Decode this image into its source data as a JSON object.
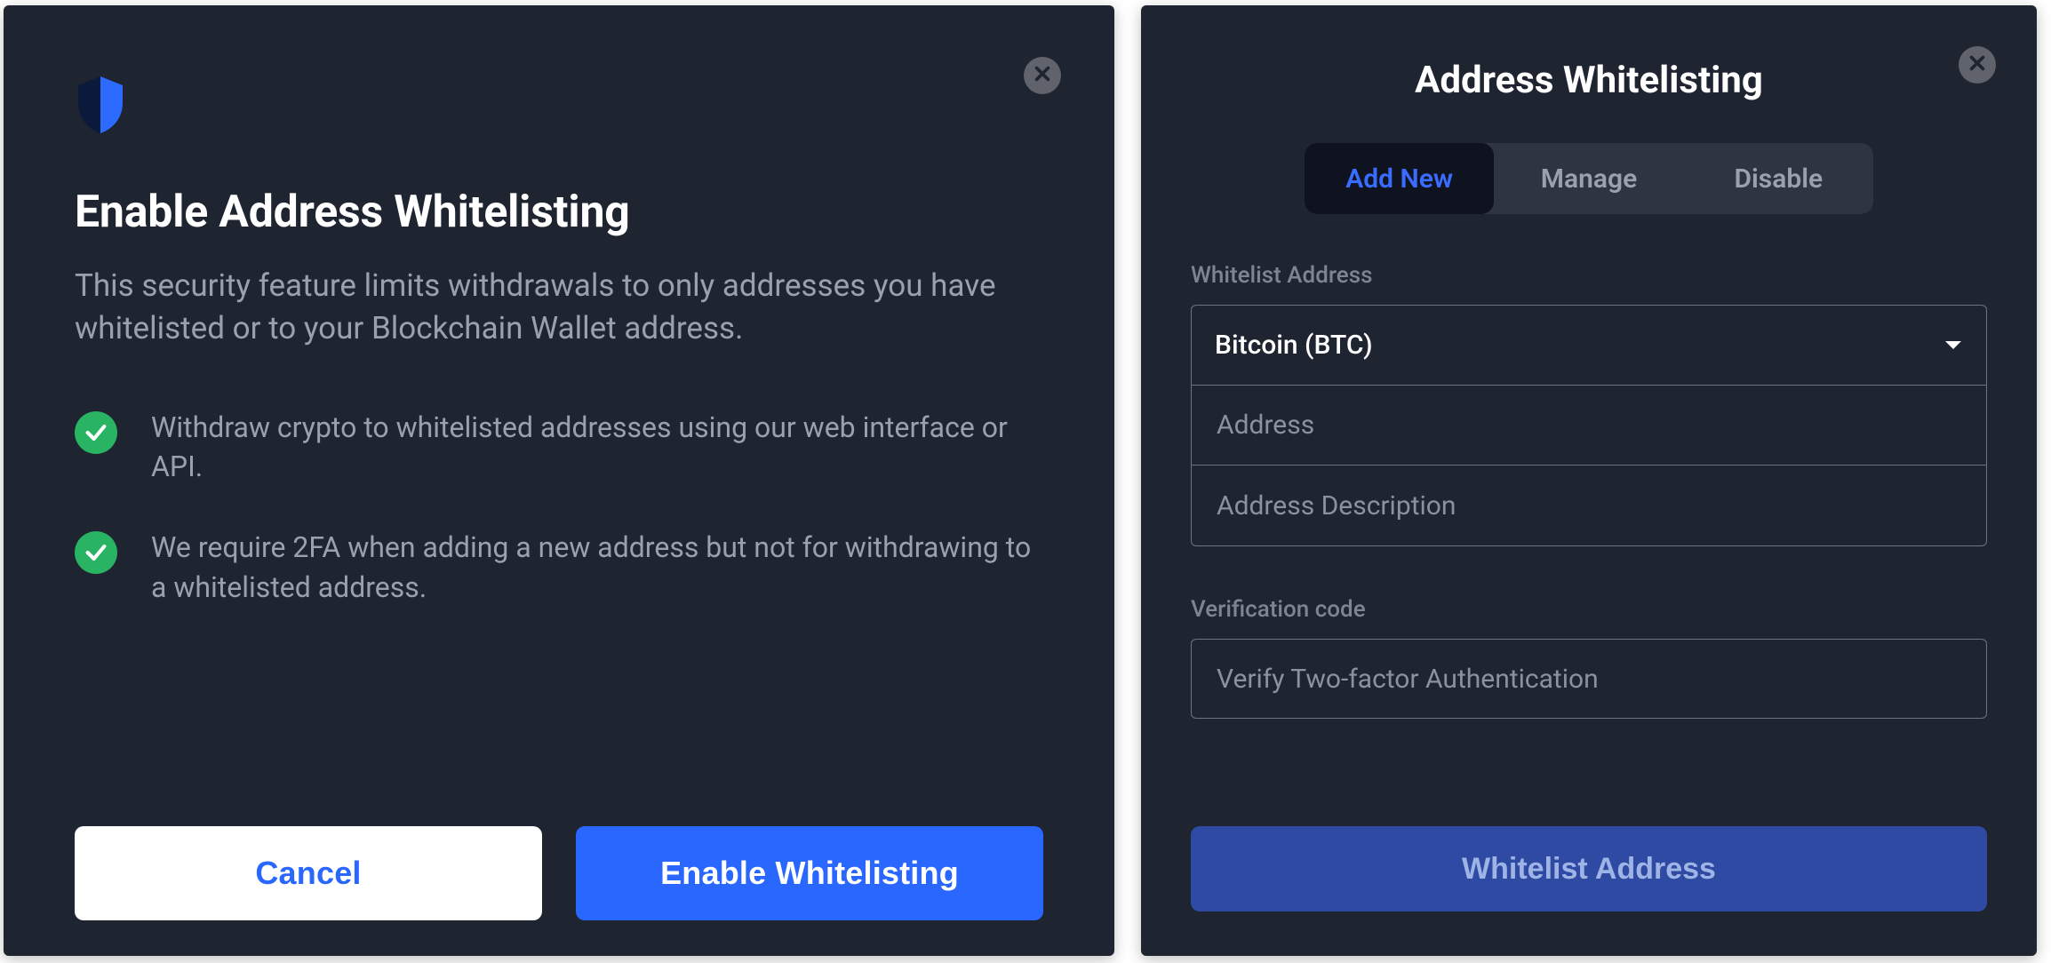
{
  "left": {
    "title": "Enable Address Whitelisting",
    "subtitle": "This security feature limits withdrawals to only addresses you have whitelisted or to your Blockchain Wallet address.",
    "bullets": [
      "Withdraw crypto to whitelisted addresses using our web interface or API.",
      "We require 2FA when adding a new address but not for withdrawing to a whitelisted address."
    ],
    "cancel_label": "Cancel",
    "enable_label": "Enable Whitelisting"
  },
  "right": {
    "title": "Address Whitelisting",
    "tabs": [
      "Add New",
      "Manage",
      "Disable"
    ],
    "active_tab_index": 0,
    "section_label_1": "Whitelist Address",
    "currency_selected": "Bitcoin (BTC)",
    "address_placeholder": "Address",
    "description_placeholder": "Address Description",
    "section_label_2": "Verification code",
    "verification_placeholder": "Verify Two-factor Authentication",
    "submit_label": "Whitelist Address"
  },
  "icons": {
    "shield": "shield-icon",
    "close": "close-icon",
    "check": "check-icon",
    "caret": "caret-down-icon"
  }
}
